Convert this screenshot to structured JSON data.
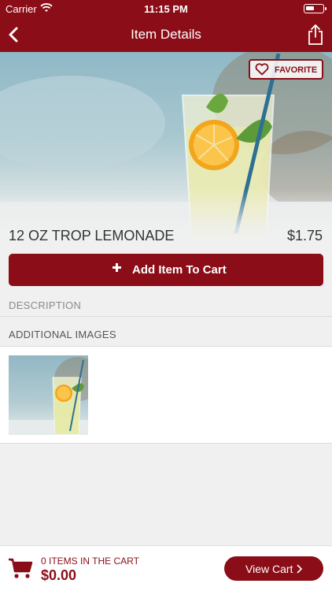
{
  "status_bar": {
    "carrier": "Carrier",
    "time": "11:15 PM"
  },
  "nav": {
    "title": "Item Details",
    "back_icon": "chevron-left-icon",
    "share_icon": "share-icon"
  },
  "item": {
    "favorite_label": "FAVORITE",
    "name": "12 OZ TROP LEMONADE",
    "price": "$1.75",
    "add_button_label": "Add Item To Cart"
  },
  "sections": {
    "description_label": "DESCRIPTION",
    "additional_images_label": "ADDITIONAL IMAGES"
  },
  "footer": {
    "cart_count_text": "0 ITEMS IN THE CART",
    "cart_total": "$0.00",
    "view_cart_label": "View Cart"
  },
  "colors": {
    "brand": "#8b0d17",
    "background": "#f0f0f0"
  }
}
